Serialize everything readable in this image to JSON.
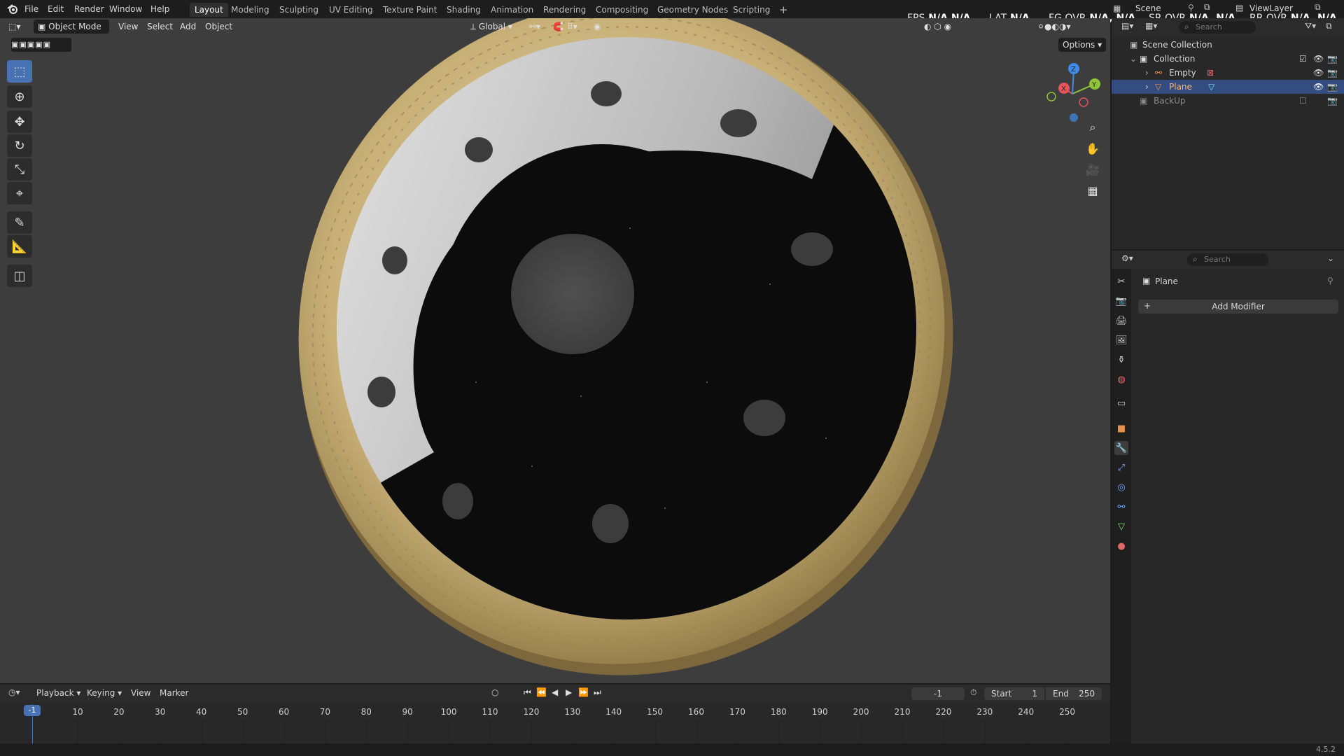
{
  "menu": [
    "File",
    "Edit",
    "Render",
    "Window",
    "Help"
  ],
  "workspaces": [
    "Layout",
    "Modeling",
    "Sculpting",
    "UV Editing",
    "Texture Paint",
    "Shading",
    "Animation",
    "Rendering",
    "Compositing",
    "Geometry Nodes",
    "Scripting"
  ],
  "add_workspace": "+",
  "scene_field": "Scene",
  "viewlayer_field": "ViewLayer",
  "stats": {
    "fps_label": "FPS",
    "fps_val": "N/A",
    "fps_val2": "N/A",
    "lat_label": "LAT",
    "lat_val": "N/A",
    "fgovr_label": "FG OVR",
    "fgovr_val": "N/A,",
    "fgovr_val2": "N/A",
    "srovr_label": "SR OVR",
    "srovr_val": "N/A,",
    "srovr_val2": "N/A",
    "rrovr_label": "RR OVR",
    "rrovr_val": "N/A,",
    "rrovr_val2": "N/A"
  },
  "viewport_header": {
    "mode": "Object Mode",
    "view": "View",
    "select": "Select",
    "add": "Add",
    "object": "Object",
    "transform_orientation": "Global",
    "options": "Options",
    "search_placeholder": "Search"
  },
  "gizmo": {
    "x": "X",
    "y": "Y",
    "z": "Z"
  },
  "outliner": {
    "search_placeholder": "Search",
    "scene_collection": "Scene Collection",
    "collection": "Collection",
    "items": [
      "Empty",
      "Plane"
    ],
    "backup": "BackUp"
  },
  "properties": {
    "search_placeholder": "Search",
    "object_name": "Plane",
    "add_modifier": "Add Modifier"
  },
  "timeline": {
    "playback": "Playback",
    "keying": "Keying",
    "view": "View",
    "marker": "Marker",
    "current_frame": "-1",
    "start_label": "Start",
    "start_value": "1",
    "end_label": "End",
    "end_value": "250",
    "ruler": [
      "10",
      "20",
      "30",
      "40",
      "50",
      "60",
      "70",
      "80",
      "90",
      "100",
      "110",
      "120",
      "130",
      "140",
      "150",
      "160",
      "170",
      "180",
      "190",
      "200",
      "210",
      "220",
      "230",
      "240",
      "250"
    ],
    "playhead_label": "-1"
  },
  "version": "4.5.2",
  "colors": {
    "accent": "#4772b3",
    "selected_row": "#334d80",
    "gold": "#c8b077"
  }
}
